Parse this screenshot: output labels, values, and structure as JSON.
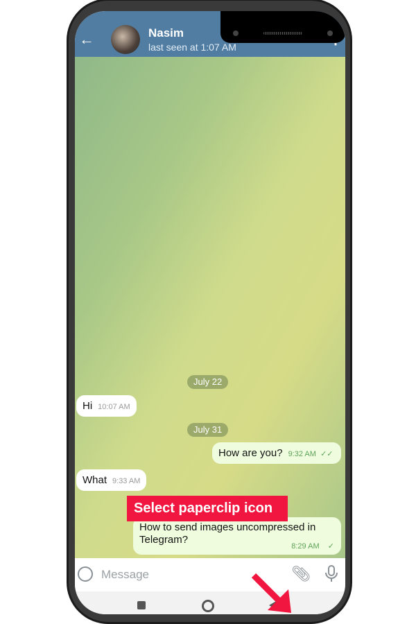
{
  "header": {
    "contact_name": "Nasim",
    "status": "last seen at 1:07 AM",
    "back_icon": "arrow-left-icon",
    "call_icon": "phone-icon",
    "menu_icon": "more-vertical-icon",
    "header_color": "#517da2"
  },
  "messages": [
    {
      "type": "date",
      "text": "July 22"
    },
    {
      "type": "in",
      "text": "Hi",
      "time": "10:07 AM"
    },
    {
      "type": "date",
      "text": "July 31"
    },
    {
      "type": "out",
      "text": "How are you?",
      "time": "9:32 AM",
      "ticks": "✓✓"
    },
    {
      "type": "in",
      "text": "What",
      "time": "9:33 AM"
    },
    {
      "type": "out",
      "text": "How to send images uncompressed in Telegram?",
      "time": "8:29 AM",
      "ticks": "✓"
    }
  ],
  "annotation": {
    "text": "Select paperclip icon",
    "color": "#f0163f"
  },
  "input": {
    "placeholder": "Message",
    "emoji_icon": "smiley-icon",
    "attach_icon": "paperclip-icon",
    "mic_icon": "microphone-icon"
  }
}
